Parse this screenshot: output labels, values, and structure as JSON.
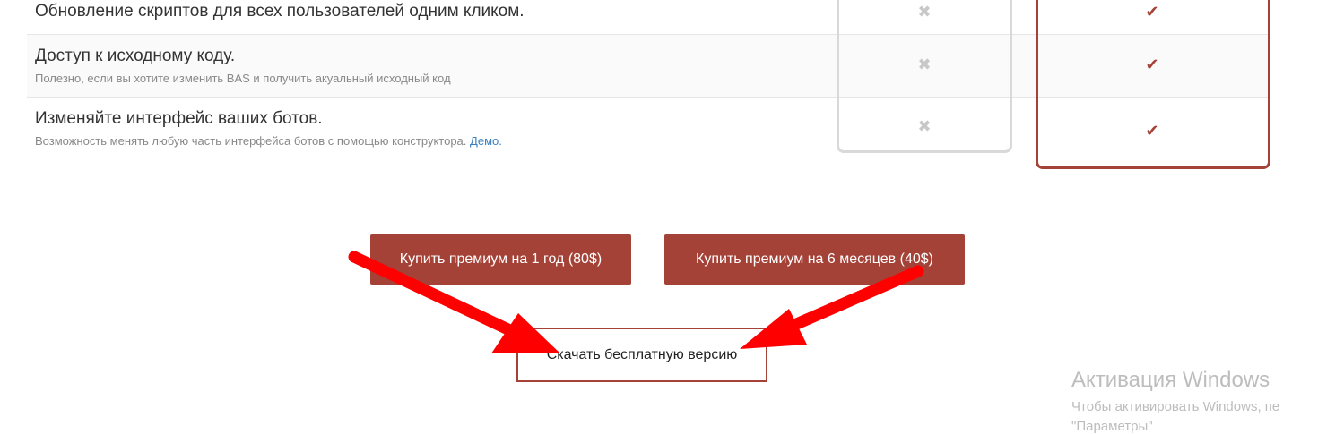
{
  "features": [
    {
      "title": "Обновление скриптов для всех пользователей одним кликом.",
      "subtitle": "",
      "free": "✖",
      "premium": "✔"
    },
    {
      "title": "Доступ к исходному коду.",
      "subtitle": "Полезно, если вы хотите изменить BAS и получить акуальный исходный код",
      "free": "✖",
      "premium": "✔"
    },
    {
      "title": "Изменяйте интерфейс ваших ботов.",
      "subtitle": "Возможность менять любую часть интерфейса ботов с помощью конструктора.",
      "link": "Демо.",
      "free": "✖",
      "premium": "✔"
    }
  ],
  "buttons": {
    "buy_year": "Купить премиум на 1 год (80$)",
    "buy_6m": "Купить премиум на 6 месяцев (40$)",
    "download_free": "Скачать бесплатную версию"
  },
  "watermark": {
    "title": "Активация Windows",
    "line1": "Чтобы активировать Windows, пе",
    "line2": "\"Параметры\""
  },
  "colors": {
    "accent": "#a54237",
    "arrow": "#ff0000",
    "link": "#3a7fc1"
  }
}
